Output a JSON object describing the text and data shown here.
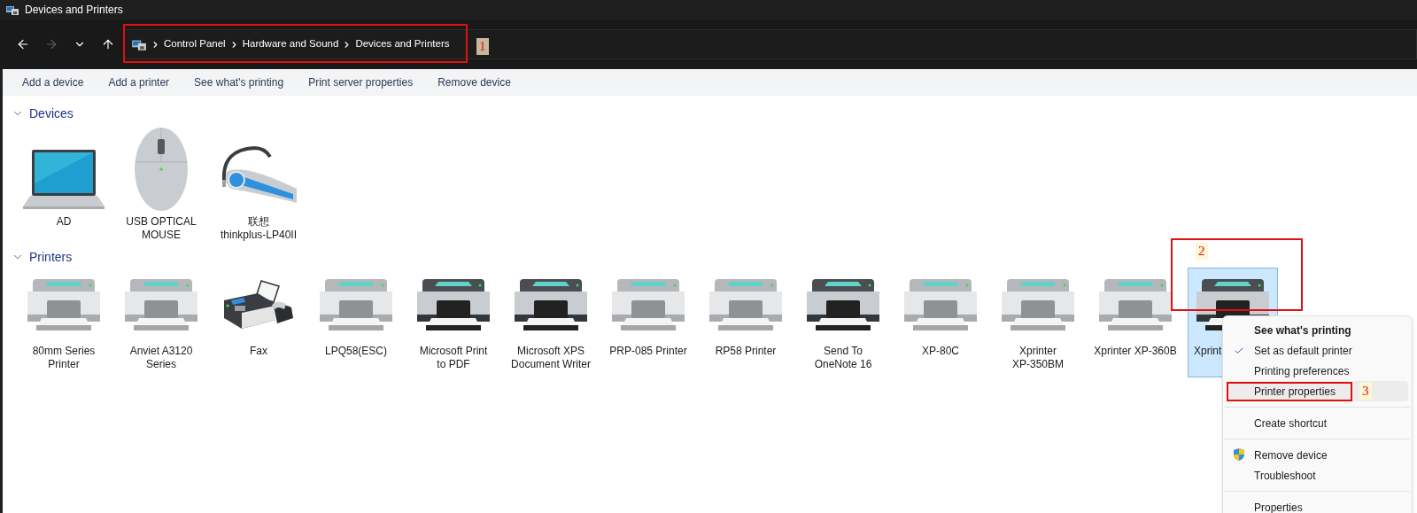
{
  "window": {
    "title": "Devices and Printers"
  },
  "nav": [
    {
      "kind": "back",
      "disabled": false
    },
    {
      "kind": "forward",
      "disabled": true
    },
    {
      "kind": "recent",
      "disabled": false
    },
    {
      "kind": "up",
      "disabled": false
    }
  ],
  "breadcrumb": [
    "Control Panel",
    "Hardware and Sound",
    "Devices and Printers"
  ],
  "commands": [
    "Add a device",
    "Add a printer",
    "See what's printing",
    "Print server properties",
    "Remove device"
  ],
  "sections": [
    {
      "title": "Devices",
      "expanded": true,
      "items": [
        {
          "kind": "laptop",
          "label": "AD",
          "selected": false
        },
        {
          "kind": "mouse",
          "label": "USB OPTICAL\nMOUSE",
          "selected": false
        },
        {
          "kind": "headset",
          "label": "联想\nthinkplus-LP40II",
          "selected": false
        }
      ]
    },
    {
      "title": "Printers",
      "expanded": true,
      "items": [
        {
          "kind": "printer",
          "label": "80mm Series\nPrinter",
          "selected": false
        },
        {
          "kind": "printer",
          "label": "Anviet A3120\nSeries",
          "selected": false
        },
        {
          "kind": "fax",
          "label": "Fax",
          "selected": false
        },
        {
          "kind": "printer",
          "label": "LPQ58(ESC)",
          "selected": false
        },
        {
          "kind": "dark_printer",
          "label": "Microsoft Print\nto PDF",
          "selected": false
        },
        {
          "kind": "dark_printer",
          "label": "Microsoft XPS\nDocument Writer",
          "selected": false
        },
        {
          "kind": "printer",
          "label": "PRP-085 Printer",
          "selected": false
        },
        {
          "kind": "printer",
          "label": "RP58 Printer",
          "selected": false
        },
        {
          "kind": "dark_printer",
          "label": "Send To\nOneNote 16",
          "selected": false
        },
        {
          "kind": "printer",
          "label": "XP-80C",
          "selected": false
        },
        {
          "kind": "printer",
          "label": "Xprinter\nXP-350BM",
          "selected": false
        },
        {
          "kind": "printer",
          "label": "Xprinter XP-360B",
          "selected": false
        },
        {
          "kind": "dark_printer",
          "label": "Xprint",
          "selected": true
        }
      ]
    }
  ],
  "context_menu": [
    {
      "kind": "item",
      "label": "See what's printing",
      "default": true,
      "checked": false,
      "selected": false
    },
    {
      "kind": "item",
      "label": "Set as default printer",
      "default": false,
      "checked": true,
      "selected": false
    },
    {
      "kind": "item",
      "label": "Printing preferences",
      "default": false,
      "checked": false,
      "selected": false
    },
    {
      "kind": "item",
      "label": "Printer properties",
      "default": false,
      "checked": false,
      "selected": true
    },
    {
      "kind": "separator"
    },
    {
      "kind": "item",
      "label": "Create shortcut",
      "default": false,
      "checked": false,
      "selected": false
    },
    {
      "kind": "separator"
    },
    {
      "kind": "admin_item",
      "label": "Remove device",
      "default": false,
      "checked": false,
      "selected": false
    },
    {
      "kind": "item",
      "label": "Troubleshoot",
      "default": false,
      "checked": false,
      "selected": false
    },
    {
      "kind": "separator"
    },
    {
      "kind": "item",
      "label": "Properties",
      "default": false,
      "checked": false,
      "selected": false
    }
  ],
  "annotations": [
    {
      "label": "1"
    },
    {
      "label": "2"
    },
    {
      "label": "3"
    }
  ]
}
